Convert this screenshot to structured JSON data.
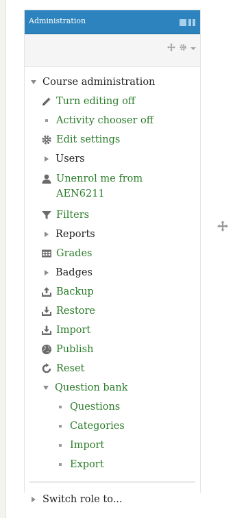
{
  "block": {
    "title": "Administration",
    "icons": [
      "dock-icon",
      "move-icon",
      "gear-icon",
      "chevron-down-icon"
    ]
  },
  "tree": {
    "course_admin": "Course administration",
    "turn_editing_off": "Turn editing off",
    "activity_chooser_off": "Activity chooser off",
    "edit_settings": "Edit settings",
    "users": "Users",
    "unenrol_line1": "Unenrol me from",
    "unenrol_line2": "AEN6211",
    "filters": "Filters",
    "reports": "Reports",
    "grades": "Grades",
    "badges": "Badges",
    "backup": "Backup",
    "restore": "Restore",
    "import": "Import",
    "publish": "Publish",
    "reset": "Reset",
    "question_bank": "Question bank",
    "qb_questions": "Questions",
    "qb_categories": "Categories",
    "qb_import": "Import",
    "qb_export": "Export",
    "switch_role": "Switch role to..."
  },
  "colors": {
    "header": "#2d83bd",
    "link": "#2a7c2a",
    "text": "#222222",
    "icon": "#8b8b8b"
  }
}
